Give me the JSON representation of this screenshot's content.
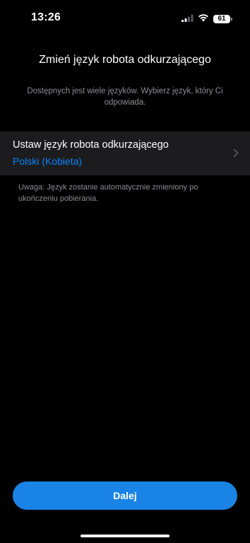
{
  "status_bar": {
    "time": "13:26",
    "battery": "61",
    "icons": [
      "signal-icon",
      "wifi-icon",
      "battery-icon"
    ]
  },
  "header": {
    "title": "Zmień język robota odkurzającego",
    "description": "Dostępnych jest wiele języków. Wybierz język, który Ci odpowiada."
  },
  "setting": {
    "label": "Ustaw język robota odkurzającego",
    "value": "Polski (Kobieta)",
    "icon": "chevron-right-icon"
  },
  "note": "Uwaga: Język zostanie automatycznie zmieniony po ukończeniu pobierania.",
  "footer": {
    "next_label": "Dalej"
  },
  "colors": {
    "background": "#000000",
    "row_background": "#1c1c1e",
    "accent": "#0a84ff",
    "button": "#1a84e6",
    "secondary_text": "#8e8e93"
  }
}
